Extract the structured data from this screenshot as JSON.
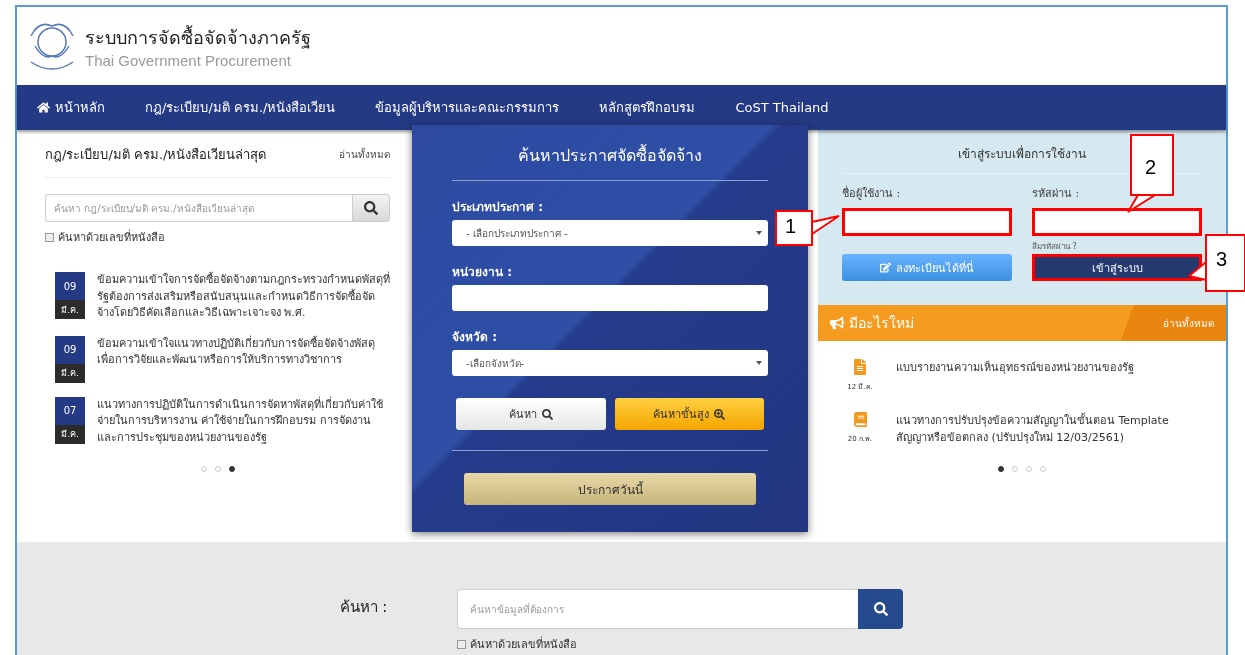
{
  "header": {
    "title": "ระบบการจัดซื้อจัดจ้างภาครัฐ",
    "subtitle": "Thai Government Procurement"
  },
  "nav": [
    {
      "label": "หน้าหลัก",
      "kind": "home"
    },
    {
      "label": "กฎ/ระเบียบ/มติ ครม./หนังสือเวียน",
      "kind": "link"
    },
    {
      "label": "ข้อมูลผู้บริหารและคณะกรรมการ",
      "kind": "link"
    },
    {
      "label": "หลักสูตรฝึกอบรม",
      "kind": "link"
    },
    {
      "label": "CoST Thailand",
      "kind": "link"
    }
  ],
  "circulars": {
    "title": "กฎ/ระเบียบ/มติ ครม./หนังสือเวียนล่าสุด",
    "read_all": "อ่านทั้งหมด",
    "search": {
      "placeholder": "ค้นหา กฎ/ระเบียบ/มติ ครม./หนังสือเวียนล่าสุด"
    },
    "by_number": {
      "label": "ค้นหาด้วยเลขที่หนังสือ",
      "checked": false
    },
    "items": [
      {
        "day": "09",
        "month": "มี.ค.",
        "text": "ข้อมความเข้าใจการจัดซื้อจัดจ้างตามกฎกระทรวงกำหนดพัสดุที่รัฐต้องการส่งเสริมหรือสนับสนุนและกำหนดวิธีการจัดซื้อจัดจ้างโดยวิธีคัดเลือกและวิธีเฉพาะเจาะจง พ.ศ."
      },
      {
        "day": "09",
        "month": "มี.ค.",
        "text": "ข้อมความเข้าใจแนวทางปฏิบัติเกี่ยวกับการจัดซื้อจัดจ้างพัสดุเพื่อการวิจัยและพัฒนาหรือการให้บริการทางวิชาการ"
      },
      {
        "day": "07",
        "month": "มี.ค.",
        "text": "แนวทางการปฏิบัติในการดำเนินการจัดหาพัสดุที่เกี่ยวกับค่าใช้จ่ายในการบริหารงาน ค่าใช้จ่ายในการฝึกอบรม การจัดงาน และการประชุมของหน่วยงานของรัฐ"
      }
    ],
    "pager": [
      {
        "selected": false
      },
      {
        "selected": false
      },
      {
        "selected": true
      }
    ]
  },
  "procurement_search": {
    "title": "ค้นหาประกาศจัดซื้อจัดจ้าง",
    "fields": [
      {
        "label": "ประเภทประกาศ :",
        "kind": "select",
        "value": "- เลือกประเภทประกาศ -"
      },
      {
        "label": "หน่วยงาน :",
        "kind": "text"
      },
      {
        "label": "จังหวัด :",
        "kind": "select",
        "value": "-เลือกจังหวัด-"
      }
    ],
    "buttons": [
      {
        "label": "ค้นหา",
        "kind": "search"
      },
      {
        "label": "ค้นหาขั้นสูง",
        "kind": "advanced"
      }
    ],
    "today_button": "ประกาศวันนี้"
  },
  "login": {
    "title": "เข้าสู่ระบบเพื่อการใช้งาน",
    "username": {
      "label": "ชื่อผู้ใช้งาน :",
      "highlighted": true
    },
    "password": {
      "label": "รหัสผ่าน :",
      "highlighted": true
    },
    "forgot": "ลืมรหัสผ่าน ?",
    "register_button": "ลงทะเบียนได้ที่นี่",
    "login_button": {
      "label": "เข้าสู่ระบบ",
      "highlighted": true
    }
  },
  "whats_new": {
    "title": "มีอะไรใหม่",
    "read_all": "อ่านทั้งหมด",
    "items": [
      {
        "kind": "document",
        "date": "12 มี.ค.",
        "text": "แบบรายงานความเห็นอุทธรณ์ของหน่วยงานของรัฐ"
      },
      {
        "kind": "book",
        "date": "20 ก.พ.",
        "text": "แนวทางการปรับปรุงข้อความสัญญาในขั้นตอน Template สัญญาหรือข้อตกลง (ปรับปรุงใหม่ 12/03/2561)"
      }
    ],
    "pager": [
      {
        "selected": true
      },
      {
        "selected": false
      },
      {
        "selected": false
      },
      {
        "selected": false
      }
    ]
  },
  "site_search": {
    "label": "ค้นหา :",
    "placeholder": "ค้นหาข้อมูลที่ต้องการ",
    "by_number": {
      "label": "ค้นหาด้วยเลขที่หนังสือ",
      "checked": false
    }
  },
  "callouts": [
    {
      "number": "1"
    },
    {
      "number": "2"
    },
    {
      "number": "3"
    }
  ]
}
